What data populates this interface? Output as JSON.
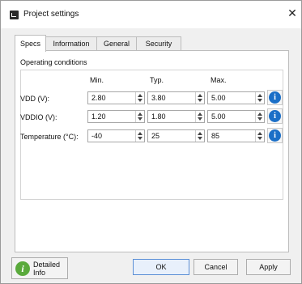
{
  "window": {
    "title": "Project settings",
    "close_glyph": "✕"
  },
  "tabs": [
    {
      "label": "Specs"
    },
    {
      "label": "Information"
    },
    {
      "label": "General"
    },
    {
      "label": "Security"
    }
  ],
  "specs": {
    "group_title": "Operating conditions",
    "columns": {
      "min": "Min.",
      "typ": "Typ.",
      "max": "Max."
    },
    "rows": [
      {
        "label": "VDD (V):",
        "min": "2.80",
        "typ": "3.80",
        "max": "5.00"
      },
      {
        "label": "VDDIO (V):",
        "min": "1.20",
        "typ": "1.80",
        "max": "5.00"
      },
      {
        "label": "Temperature (°C):",
        "min": "-40",
        "typ": "25",
        "max": "85"
      }
    ],
    "info_glyph": "i"
  },
  "footer": {
    "detailed_info_line1": "Detailed",
    "detailed_info_line2": "Info",
    "detailed_info_glyph": "i",
    "ok": "OK",
    "cancel": "Cancel",
    "apply": "Apply"
  },
  "colors": {
    "info_blue": "#1b6fc7",
    "detail_green": "#5aaa3c"
  },
  "icons": [
    "app-icon",
    "close-icon",
    "info-icon",
    "detailed-info-icon",
    "spin-up-icon",
    "spin-down-icon"
  ]
}
